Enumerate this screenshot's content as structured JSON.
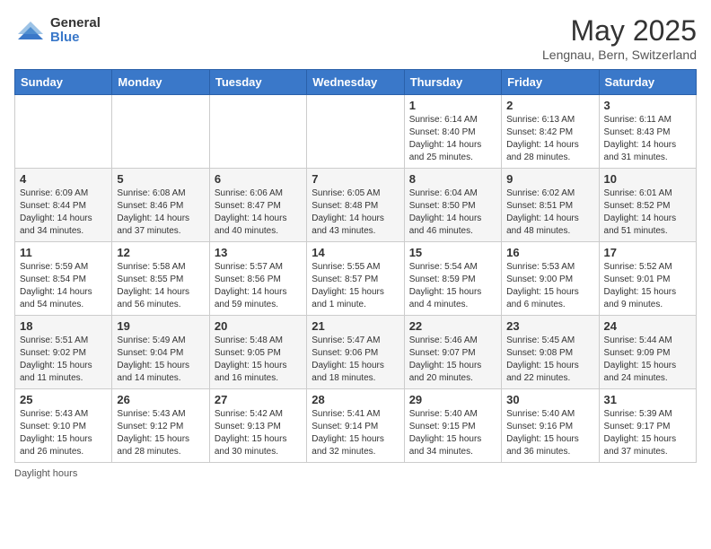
{
  "header": {
    "logo_general": "General",
    "logo_blue": "Blue",
    "month_title": "May 2025",
    "location": "Lengnau, Bern, Switzerland"
  },
  "days_of_week": [
    "Sunday",
    "Monday",
    "Tuesday",
    "Wednesday",
    "Thursday",
    "Friday",
    "Saturday"
  ],
  "weeks": [
    [
      {
        "day": "",
        "sunrise": "",
        "sunset": "",
        "daylight": ""
      },
      {
        "day": "",
        "sunrise": "",
        "sunset": "",
        "daylight": ""
      },
      {
        "day": "",
        "sunrise": "",
        "sunset": "",
        "daylight": ""
      },
      {
        "day": "",
        "sunrise": "",
        "sunset": "",
        "daylight": ""
      },
      {
        "day": "1",
        "sunrise": "Sunrise: 6:14 AM",
        "sunset": "Sunset: 8:40 PM",
        "daylight": "Daylight: 14 hours and 25 minutes."
      },
      {
        "day": "2",
        "sunrise": "Sunrise: 6:13 AM",
        "sunset": "Sunset: 8:42 PM",
        "daylight": "Daylight: 14 hours and 28 minutes."
      },
      {
        "day": "3",
        "sunrise": "Sunrise: 6:11 AM",
        "sunset": "Sunset: 8:43 PM",
        "daylight": "Daylight: 14 hours and 31 minutes."
      }
    ],
    [
      {
        "day": "4",
        "sunrise": "Sunrise: 6:09 AM",
        "sunset": "Sunset: 8:44 PM",
        "daylight": "Daylight: 14 hours and 34 minutes."
      },
      {
        "day": "5",
        "sunrise": "Sunrise: 6:08 AM",
        "sunset": "Sunset: 8:46 PM",
        "daylight": "Daylight: 14 hours and 37 minutes."
      },
      {
        "day": "6",
        "sunrise": "Sunrise: 6:06 AM",
        "sunset": "Sunset: 8:47 PM",
        "daylight": "Daylight: 14 hours and 40 minutes."
      },
      {
        "day": "7",
        "sunrise": "Sunrise: 6:05 AM",
        "sunset": "Sunset: 8:48 PM",
        "daylight": "Daylight: 14 hours and 43 minutes."
      },
      {
        "day": "8",
        "sunrise": "Sunrise: 6:04 AM",
        "sunset": "Sunset: 8:50 PM",
        "daylight": "Daylight: 14 hours and 46 minutes."
      },
      {
        "day": "9",
        "sunrise": "Sunrise: 6:02 AM",
        "sunset": "Sunset: 8:51 PM",
        "daylight": "Daylight: 14 hours and 48 minutes."
      },
      {
        "day": "10",
        "sunrise": "Sunrise: 6:01 AM",
        "sunset": "Sunset: 8:52 PM",
        "daylight": "Daylight: 14 hours and 51 minutes."
      }
    ],
    [
      {
        "day": "11",
        "sunrise": "Sunrise: 5:59 AM",
        "sunset": "Sunset: 8:54 PM",
        "daylight": "Daylight: 14 hours and 54 minutes."
      },
      {
        "day": "12",
        "sunrise": "Sunrise: 5:58 AM",
        "sunset": "Sunset: 8:55 PM",
        "daylight": "Daylight: 14 hours and 56 minutes."
      },
      {
        "day": "13",
        "sunrise": "Sunrise: 5:57 AM",
        "sunset": "Sunset: 8:56 PM",
        "daylight": "Daylight: 14 hours and 59 minutes."
      },
      {
        "day": "14",
        "sunrise": "Sunrise: 5:55 AM",
        "sunset": "Sunset: 8:57 PM",
        "daylight": "Daylight: 15 hours and 1 minute."
      },
      {
        "day": "15",
        "sunrise": "Sunrise: 5:54 AM",
        "sunset": "Sunset: 8:59 PM",
        "daylight": "Daylight: 15 hours and 4 minutes."
      },
      {
        "day": "16",
        "sunrise": "Sunrise: 5:53 AM",
        "sunset": "Sunset: 9:00 PM",
        "daylight": "Daylight: 15 hours and 6 minutes."
      },
      {
        "day": "17",
        "sunrise": "Sunrise: 5:52 AM",
        "sunset": "Sunset: 9:01 PM",
        "daylight": "Daylight: 15 hours and 9 minutes."
      }
    ],
    [
      {
        "day": "18",
        "sunrise": "Sunrise: 5:51 AM",
        "sunset": "Sunset: 9:02 PM",
        "daylight": "Daylight: 15 hours and 11 minutes."
      },
      {
        "day": "19",
        "sunrise": "Sunrise: 5:49 AM",
        "sunset": "Sunset: 9:04 PM",
        "daylight": "Daylight: 15 hours and 14 minutes."
      },
      {
        "day": "20",
        "sunrise": "Sunrise: 5:48 AM",
        "sunset": "Sunset: 9:05 PM",
        "daylight": "Daylight: 15 hours and 16 minutes."
      },
      {
        "day": "21",
        "sunrise": "Sunrise: 5:47 AM",
        "sunset": "Sunset: 9:06 PM",
        "daylight": "Daylight: 15 hours and 18 minutes."
      },
      {
        "day": "22",
        "sunrise": "Sunrise: 5:46 AM",
        "sunset": "Sunset: 9:07 PM",
        "daylight": "Daylight: 15 hours and 20 minutes."
      },
      {
        "day": "23",
        "sunrise": "Sunrise: 5:45 AM",
        "sunset": "Sunset: 9:08 PM",
        "daylight": "Daylight: 15 hours and 22 minutes."
      },
      {
        "day": "24",
        "sunrise": "Sunrise: 5:44 AM",
        "sunset": "Sunset: 9:09 PM",
        "daylight": "Daylight: 15 hours and 24 minutes."
      }
    ],
    [
      {
        "day": "25",
        "sunrise": "Sunrise: 5:43 AM",
        "sunset": "Sunset: 9:10 PM",
        "daylight": "Daylight: 15 hours and 26 minutes."
      },
      {
        "day": "26",
        "sunrise": "Sunrise: 5:43 AM",
        "sunset": "Sunset: 9:12 PM",
        "daylight": "Daylight: 15 hours and 28 minutes."
      },
      {
        "day": "27",
        "sunrise": "Sunrise: 5:42 AM",
        "sunset": "Sunset: 9:13 PM",
        "daylight": "Daylight: 15 hours and 30 minutes."
      },
      {
        "day": "28",
        "sunrise": "Sunrise: 5:41 AM",
        "sunset": "Sunset: 9:14 PM",
        "daylight": "Daylight: 15 hours and 32 minutes."
      },
      {
        "day": "29",
        "sunrise": "Sunrise: 5:40 AM",
        "sunset": "Sunset: 9:15 PM",
        "daylight": "Daylight: 15 hours and 34 minutes."
      },
      {
        "day": "30",
        "sunrise": "Sunrise: 5:40 AM",
        "sunset": "Sunset: 9:16 PM",
        "daylight": "Daylight: 15 hours and 36 minutes."
      },
      {
        "day": "31",
        "sunrise": "Sunrise: 5:39 AM",
        "sunset": "Sunset: 9:17 PM",
        "daylight": "Daylight: 15 hours and 37 minutes."
      }
    ]
  ],
  "footer": {
    "note": "Daylight hours"
  }
}
